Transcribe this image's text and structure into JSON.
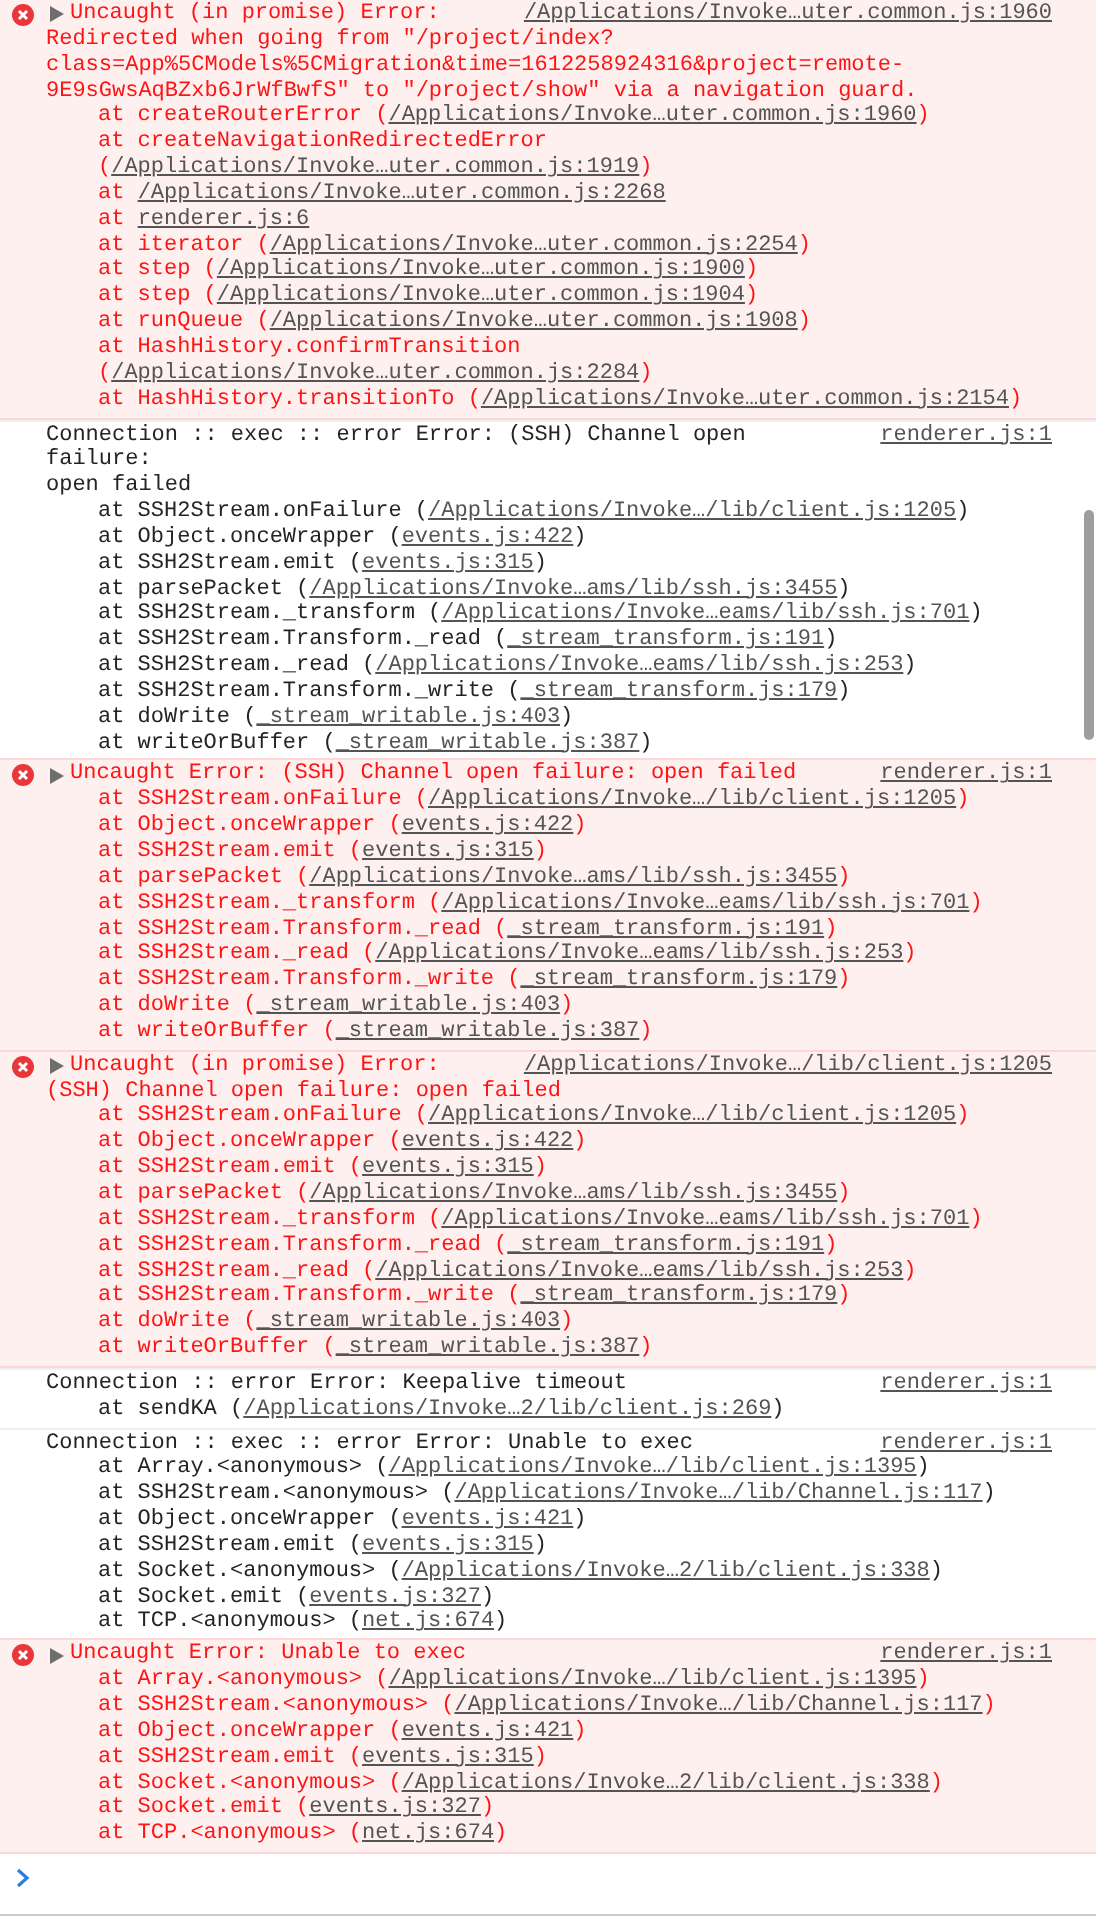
{
  "messages": [
    {
      "kind": "error",
      "text": "Uncaught (in promise) Error:",
      "detail": "Redirected when going from \"/project/index?\nclass=App%5CModels%5CMigration&time=1612258924316&project=remote-\n9E9sGwsAqBZxb6JrWfBwfS\" to \"/project/show\" via a navigation guard.",
      "source": "/Applications/Invoke…uter.common.js:1960",
      "frames": [
        {
          "call": "at createRouterError",
          "open": "(",
          "location": "/Applications/Invoke…uter.common.js:1960",
          "close": ")"
        },
        {
          "call": "at createNavigationRedirectedError",
          "open": "(",
          "location": "/Applications/Invoke…uter.common.js:1919",
          "close": ")"
        },
        {
          "call": "at",
          "location": "/Applications/Invoke…uter.common.js:2268"
        },
        {
          "call": "at",
          "location": "renderer.js:6"
        },
        {
          "call": "at iterator",
          "open": "(",
          "location": "/Applications/Invoke…uter.common.js:2254",
          "close": ")"
        },
        {
          "call": "at step",
          "open": "(",
          "location": "/Applications/Invoke…uter.common.js:1900",
          "close": ")"
        },
        {
          "call": "at step",
          "open": "(",
          "location": "/Applications/Invoke…uter.common.js:1904",
          "close": ")"
        },
        {
          "call": "at runQueue",
          "open": "(",
          "location": "/Applications/Invoke…uter.common.js:1908",
          "close": ")"
        },
        {
          "call": "at HashHistory.confirmTransition",
          "open": "(",
          "location": "/Applications/Invoke…uter.common.js:2284",
          "close": ")"
        },
        {
          "call": "at HashHistory.transitionTo",
          "open": "(",
          "location": "/Applications/Invoke…uter.common.js:2154",
          "close": ")"
        }
      ]
    },
    {
      "kind": "log",
      "text": "Connection :: exec :: error Error: (SSH) Channel open failure:",
      "detail": "open failed",
      "source": "renderer.js:1",
      "frames": [
        {
          "call": "at SSH2Stream.onFailure",
          "open": "(",
          "location": "/Applications/Invoke…/lib/client.js:1205",
          "close": ")"
        },
        {
          "call": "at Object.onceWrapper",
          "open": "(",
          "location": "events.js:422",
          "close": ")"
        },
        {
          "call": "at SSH2Stream.emit",
          "open": "(",
          "location": "events.js:315",
          "close": ")"
        },
        {
          "call": "at parsePacket",
          "open": "(",
          "location": "/Applications/Invoke…ams/lib/ssh.js:3455",
          "close": ")"
        },
        {
          "call": "at SSH2Stream._transform",
          "open": "(",
          "location": "/Applications/Invoke…eams/lib/ssh.js:701",
          "close": ")"
        },
        {
          "call": "at SSH2Stream.Transform._read",
          "open": "(",
          "location": "_stream_transform.js:191",
          "close": ")"
        },
        {
          "call": "at SSH2Stream._read",
          "open": "(",
          "location": "/Applications/Invoke…eams/lib/ssh.js:253",
          "close": ")"
        },
        {
          "call": "at SSH2Stream.Transform._write",
          "open": "(",
          "location": "_stream_transform.js:179",
          "close": ")"
        },
        {
          "call": "at doWrite",
          "open": "(",
          "location": "_stream_writable.js:403",
          "close": ")"
        },
        {
          "call": "at writeOrBuffer",
          "open": "(",
          "location": "_stream_writable.js:387",
          "close": ")"
        }
      ]
    },
    {
      "kind": "error",
      "text": "Uncaught Error: (SSH) Channel open failure: open failed",
      "source": "renderer.js:1",
      "frames": [
        {
          "call": "at SSH2Stream.onFailure",
          "open": "(",
          "location": "/Applications/Invoke…/lib/client.js:1205",
          "close": ")"
        },
        {
          "call": "at Object.onceWrapper",
          "open": "(",
          "location": "events.js:422",
          "close": ")"
        },
        {
          "call": "at SSH2Stream.emit",
          "open": "(",
          "location": "events.js:315",
          "close": ")"
        },
        {
          "call": "at parsePacket",
          "open": "(",
          "location": "/Applications/Invoke…ams/lib/ssh.js:3455",
          "close": ")"
        },
        {
          "call": "at SSH2Stream._transform",
          "open": "(",
          "location": "/Applications/Invoke…eams/lib/ssh.js:701",
          "close": ")"
        },
        {
          "call": "at SSH2Stream.Transform._read",
          "open": "(",
          "location": "_stream_transform.js:191",
          "close": ")"
        },
        {
          "call": "at SSH2Stream._read",
          "open": "(",
          "location": "/Applications/Invoke…eams/lib/ssh.js:253",
          "close": ")"
        },
        {
          "call": "at SSH2Stream.Transform._write",
          "open": "(",
          "location": "_stream_transform.js:179",
          "close": ")"
        },
        {
          "call": "at doWrite",
          "open": "(",
          "location": "_stream_writable.js:403",
          "close": ")"
        },
        {
          "call": "at writeOrBuffer",
          "open": "(",
          "location": "_stream_writable.js:387",
          "close": ")"
        }
      ]
    },
    {
      "kind": "error",
      "text": "Uncaught (in promise) Error:",
      "detail": "(SSH) Channel open failure: open failed",
      "source": "/Applications/Invoke…/lib/client.js:1205",
      "frames": [
        {
          "call": "at SSH2Stream.onFailure",
          "open": "(",
          "location": "/Applications/Invoke…/lib/client.js:1205",
          "close": ")"
        },
        {
          "call": "at Object.onceWrapper",
          "open": "(",
          "location": "events.js:422",
          "close": ")"
        },
        {
          "call": "at SSH2Stream.emit",
          "open": "(",
          "location": "events.js:315",
          "close": ")"
        },
        {
          "call": "at parsePacket",
          "open": "(",
          "location": "/Applications/Invoke…ams/lib/ssh.js:3455",
          "close": ")"
        },
        {
          "call": "at SSH2Stream._transform",
          "open": "(",
          "location": "/Applications/Invoke…eams/lib/ssh.js:701",
          "close": ")"
        },
        {
          "call": "at SSH2Stream.Transform._read",
          "open": "(",
          "location": "_stream_transform.js:191",
          "close": ")"
        },
        {
          "call": "at SSH2Stream._read",
          "open": "(",
          "location": "/Applications/Invoke…eams/lib/ssh.js:253",
          "close": ")"
        },
        {
          "call": "at SSH2Stream.Transform._write",
          "open": "(",
          "location": "_stream_transform.js:179",
          "close": ")"
        },
        {
          "call": "at doWrite",
          "open": "(",
          "location": "_stream_writable.js:403",
          "close": ")"
        },
        {
          "call": "at writeOrBuffer",
          "open": "(",
          "location": "_stream_writable.js:387",
          "close": ")"
        }
      ]
    },
    {
      "kind": "log",
      "text": "Connection :: error Error: Keepalive timeout",
      "source": "renderer.js:1",
      "frames": [
        {
          "call": "at sendKA",
          "open": "(",
          "location": "/Applications/Invoke…2/lib/client.js:269",
          "close": ")"
        }
      ]
    },
    {
      "kind": "log",
      "text": "Connection :: exec :: error Error: Unable to exec",
      "source": "renderer.js:1",
      "frames": [
        {
          "call": "at Array.<anonymous>",
          "open": "(",
          "location": "/Applications/Invoke…/lib/client.js:1395",
          "close": ")"
        },
        {
          "call": "at SSH2Stream.<anonymous>",
          "open": "(",
          "location": "/Applications/Invoke…/lib/Channel.js:117",
          "close": ")"
        },
        {
          "call": "at Object.onceWrapper",
          "open": "(",
          "location": "events.js:421",
          "close": ")"
        },
        {
          "call": "at SSH2Stream.emit",
          "open": "(",
          "location": "events.js:315",
          "close": ")"
        },
        {
          "call": "at Socket.<anonymous>",
          "open": "(",
          "location": "/Applications/Invoke…2/lib/client.js:338",
          "close": ")"
        },
        {
          "call": "at Socket.emit",
          "open": "(",
          "location": "events.js:327",
          "close": ")"
        },
        {
          "call": "at TCP.<anonymous>",
          "open": "(",
          "location": "net.js:674",
          "close": ")"
        }
      ]
    },
    {
      "kind": "error",
      "text": "Uncaught Error: Unable to exec",
      "source": "renderer.js:1",
      "frames": [
        {
          "call": "at Array.<anonymous>",
          "open": "(",
          "location": "/Applications/Invoke…/lib/client.js:1395",
          "close": ")"
        },
        {
          "call": "at SSH2Stream.<anonymous>",
          "open": "(",
          "location": "/Applications/Invoke…/lib/Channel.js:117",
          "close": ")"
        },
        {
          "call": "at Object.onceWrapper",
          "open": "(",
          "location": "events.js:421",
          "close": ")"
        },
        {
          "call": "at SSH2Stream.emit",
          "open": "(",
          "location": "events.js:315",
          "close": ")"
        },
        {
          "call": "at Socket.<anonymous>",
          "open": "(",
          "location": "/Applications/Invoke…2/lib/client.js:338",
          "close": ")"
        },
        {
          "call": "at Socket.emit",
          "open": "(",
          "location": "events.js:327",
          "close": ")"
        },
        {
          "call": "at TCP.<anonymous>",
          "open": "(",
          "location": "net.js:674",
          "close": ")"
        }
      ]
    }
  ]
}
